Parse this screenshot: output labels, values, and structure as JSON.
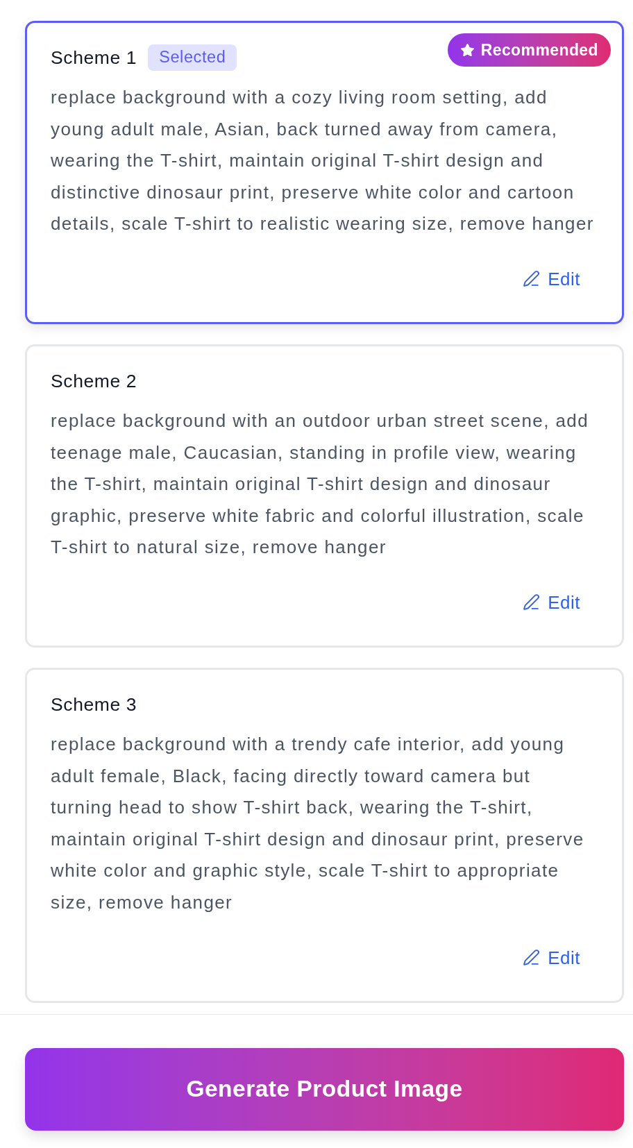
{
  "selected_badge": "Selected",
  "recommended_badge": "Recommended",
  "schemes": [
    {
      "title": "Scheme 1",
      "selected": true,
      "recommended": true,
      "description": "replace background with a cozy living room setting, add young adult male, Asian, back turned away from camera, wearing the T-shirt, maintain original T-shirt design and distinctive dinosaur print, preserve white color and cartoon details, scale T-shirt to realistic wearing size, remove hanger",
      "edit_label": "Edit"
    },
    {
      "title": "Scheme 2",
      "selected": false,
      "recommended": false,
      "description": "replace background with an outdoor urban street scene, add teenage male, Caucasian, standing in profile view, wearing the T-shirt, maintain original T-shirt design and dinosaur graphic, preserve white fabric and colorful illustration, scale T-shirt to natural size, remove hanger",
      "edit_label": "Edit"
    },
    {
      "title": "Scheme 3",
      "selected": false,
      "recommended": false,
      "description": "replace background with a trendy cafe interior, add young adult female, Black, facing directly toward camera but turning head to show T-shirt back, wearing the T-shirt, maintain original T-shirt design and dinosaur print, preserve white color and graphic style, scale T-shirt to appropriate size, remove hanger",
      "edit_label": "Edit"
    }
  ],
  "generate_button": "Generate Product Image"
}
